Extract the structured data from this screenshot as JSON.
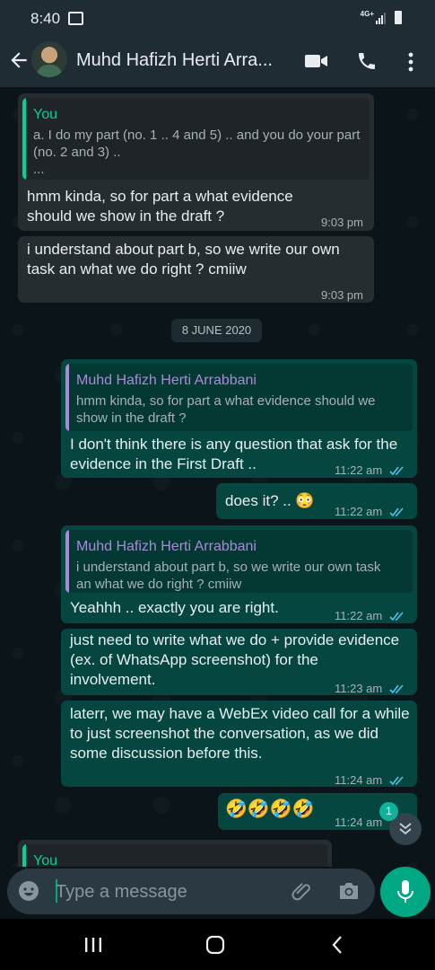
{
  "status_bar": {
    "time": "8:40",
    "network": "4G+"
  },
  "header": {
    "contact_name": "Muhd Hafizh Herti Arra..."
  },
  "messages": [
    {
      "quote_name": "You",
      "quote_text": "a. I do my part (no. 1 .. 4 and 5) .. and you do your part (no. 2 and 3) ..",
      "quote_more": "...",
      "text": "hmm kinda, so for part a what evidence should we show in the draft ?",
      "time": "9:03 pm"
    },
    {
      "text": "i understand about part b, so we write our own task an what we do right ? cmiiw",
      "time": "9:03 pm"
    },
    {
      "quote_name": "Muhd Hafizh Herti Arrabbani",
      "quote_text": "hmm kinda, so for part a what evidence should we show in the draft ?",
      "text": "I don't think there is any question that ask for the evidence in the First Draft ..",
      "time": "11:22 am"
    },
    {
      "text": "does it? .. 😳",
      "time": "11:22 am"
    },
    {
      "quote_name": "Muhd Hafizh Herti Arrabbani",
      "quote_text": "i understand about part b, so we write our own task an what we do right ? cmiiw",
      "text": "Yeahhh .. exactly you are right.",
      "time": "11:22 am"
    },
    {
      "text": "just need to write what we do + provide evidence (ex. of WhatsApp screenshot) for the involvement.",
      "time": "11:23 am"
    },
    {
      "text": "laterr, we may have a WebEx video call for a while to just screenshot the conversation, as we did some discussion before this.",
      "time": "11:24 am"
    },
    {
      "text": "🤣🤣🤣🤣",
      "time": "11:24 am"
    }
  ],
  "date_divider": "8 JUNE 2020",
  "partial_quote_name": "You",
  "unread_count": "1",
  "composer": {
    "placeholder": "Type a message"
  },
  "colors": {
    "incoming": "#262d31",
    "outgoing": "#054740",
    "accent": "#00a884",
    "quote_you": "#06cf9c",
    "quote_contact": "#a98ad6",
    "read_ticks": "#53bdeb"
  },
  "icons": [
    "back-arrow-icon",
    "video-call-icon",
    "phone-icon",
    "more-vert-icon",
    "emoji-icon",
    "attach-icon",
    "camera-icon",
    "mic-icon",
    "scroll-down-icon",
    "recent-apps-icon",
    "home-icon",
    "back-nav-icon"
  ]
}
